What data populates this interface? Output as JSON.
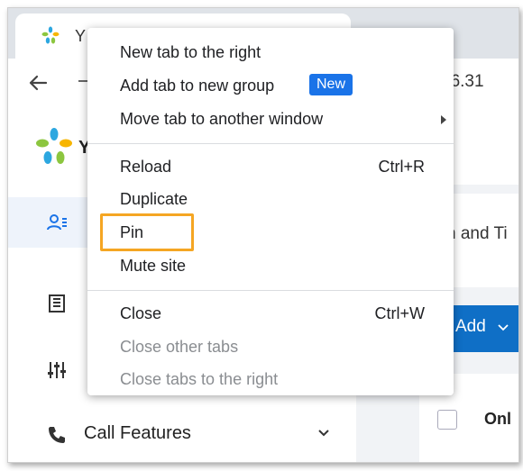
{
  "browser": {
    "tab_title": "Y",
    "address_fragment": "56.31"
  },
  "app": {
    "logo_letter": "Y",
    "sidebar_items": [
      {
        "label": "",
        "icon": "contacts-icon"
      },
      {
        "label": "",
        "icon": "extensions-icon"
      },
      {
        "label": "",
        "icon": "settings-sliders-icon"
      },
      {
        "label": "Call Features",
        "icon": "call-features-icon"
      }
    ],
    "main_heading_fragment": "n and Ti",
    "add_button_label": "Add",
    "table_header_fragment": "Onl"
  },
  "context_menu": {
    "items": [
      {
        "label": "New tab to the right",
        "shortcut": "",
        "disabled": false
      },
      {
        "label": "Add tab to new group",
        "badge": "New",
        "shortcut": "",
        "disabled": false
      },
      {
        "label": "Move tab to another window",
        "shortcut": "",
        "submenu": true,
        "disabled": false
      },
      {
        "label": "Reload",
        "shortcut": "Ctrl+R",
        "disabled": false
      },
      {
        "label": "Duplicate",
        "shortcut": "",
        "disabled": false
      },
      {
        "label": "Pin",
        "shortcut": "",
        "disabled": false,
        "highlighted": true
      },
      {
        "label": "Mute site",
        "shortcut": "",
        "disabled": false
      },
      {
        "label": "Close",
        "shortcut": "Ctrl+W",
        "disabled": false
      },
      {
        "label": "Close other tabs",
        "shortcut": "",
        "disabled": true
      },
      {
        "label": "Close tabs to the right",
        "shortcut": "",
        "disabled": true
      }
    ]
  },
  "colors": {
    "highlight": "#f5a623",
    "badge": "#1a73e8",
    "primary_button": "#0f6fc6"
  }
}
